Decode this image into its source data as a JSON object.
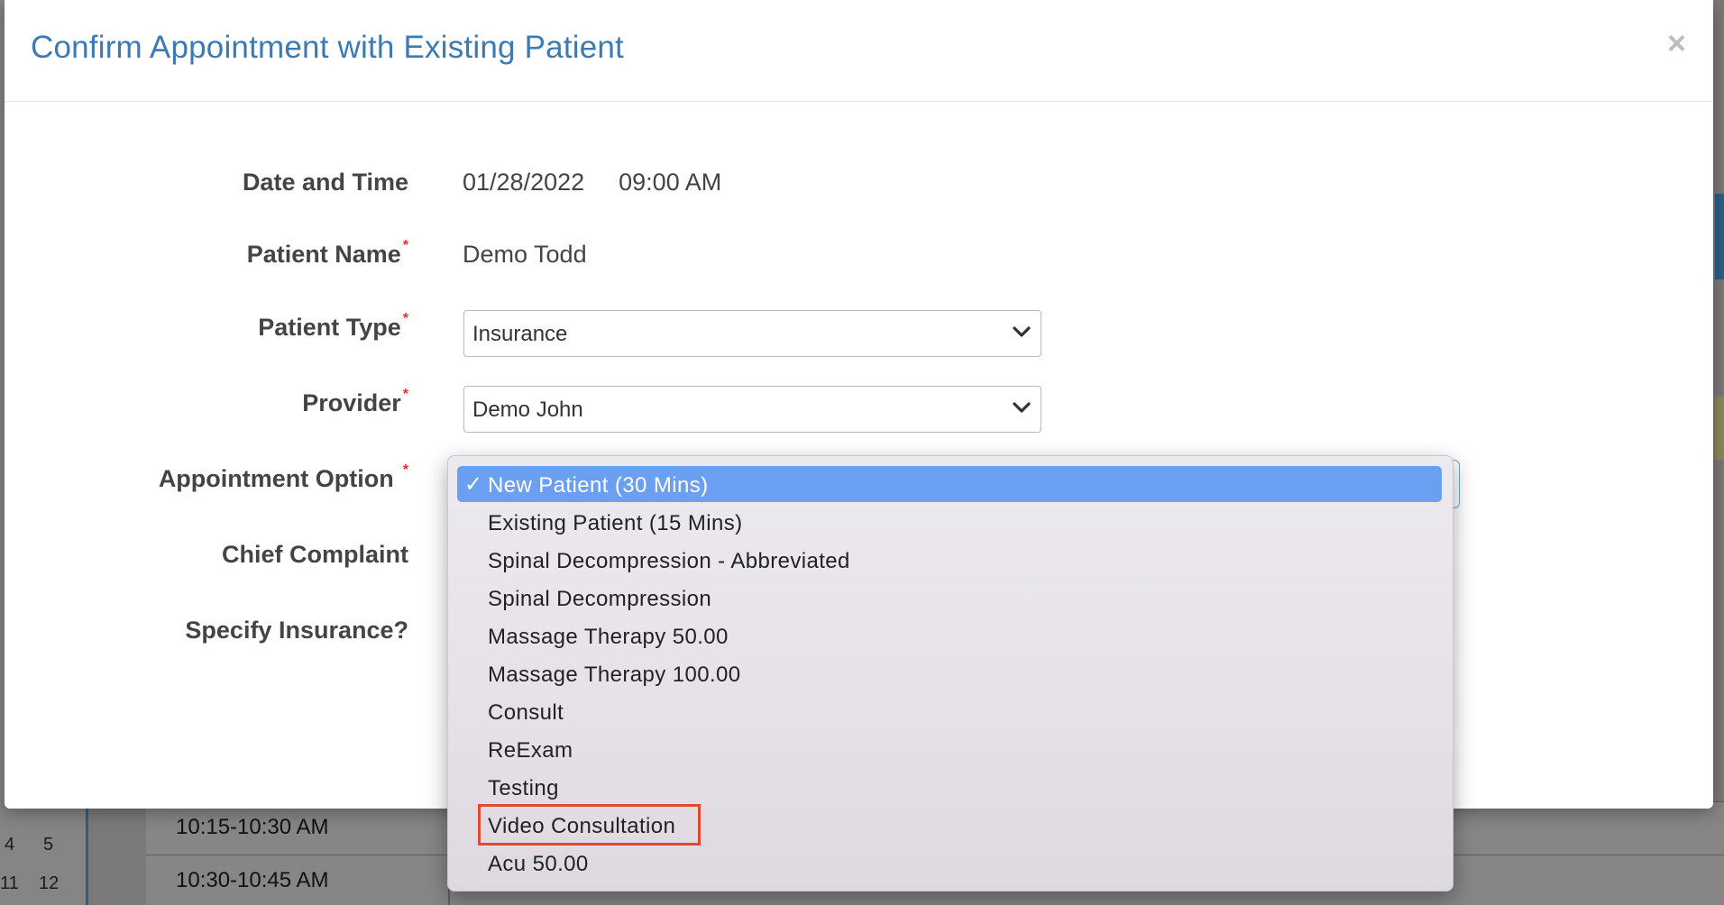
{
  "modal": {
    "title": "Confirm Appointment with Existing Patient",
    "close_symbol": "×"
  },
  "form": {
    "date_time": {
      "label": "Date and Time",
      "date": "01/28/2022",
      "time": "09:00 AM"
    },
    "patient_name": {
      "label": "Patient Name",
      "value": "Demo Todd",
      "required": "*"
    },
    "patient_type": {
      "label": "Patient Type",
      "value": "Insurance",
      "required": "*"
    },
    "provider": {
      "label": "Provider",
      "value": "Demo John",
      "required": "*"
    },
    "appointment_option": {
      "label": "Appointment Option",
      "required": "*"
    },
    "chief_complaint": {
      "label": "Chief Complaint"
    },
    "specify_insurance": {
      "label": "Specify Insurance?"
    }
  },
  "dropdown": {
    "check_symbol": "✓",
    "options": [
      "New Patient (30 Mins)",
      "Existing Patient (15 Mins)",
      "Spinal Decompression - Abbreviated",
      "Spinal Decompression",
      "Massage Therapy 50.00",
      "Massage Therapy 100.00",
      "Consult",
      "ReExam",
      "Testing",
      "Video Consultation",
      "Acu 50.00"
    ],
    "selected_index": 0,
    "highlighted_index": 9
  },
  "background": {
    "time_slots": [
      "10:15-10:30 AM",
      "10:30-10:45 AM"
    ],
    "day_numbers": [
      "4",
      "5",
      "11",
      "12"
    ]
  },
  "colors": {
    "title": "#3c7ab4",
    "selected_option": "#6a9ff1",
    "highlight_border": "#e04a2e",
    "required_marker": "#dd3333"
  }
}
